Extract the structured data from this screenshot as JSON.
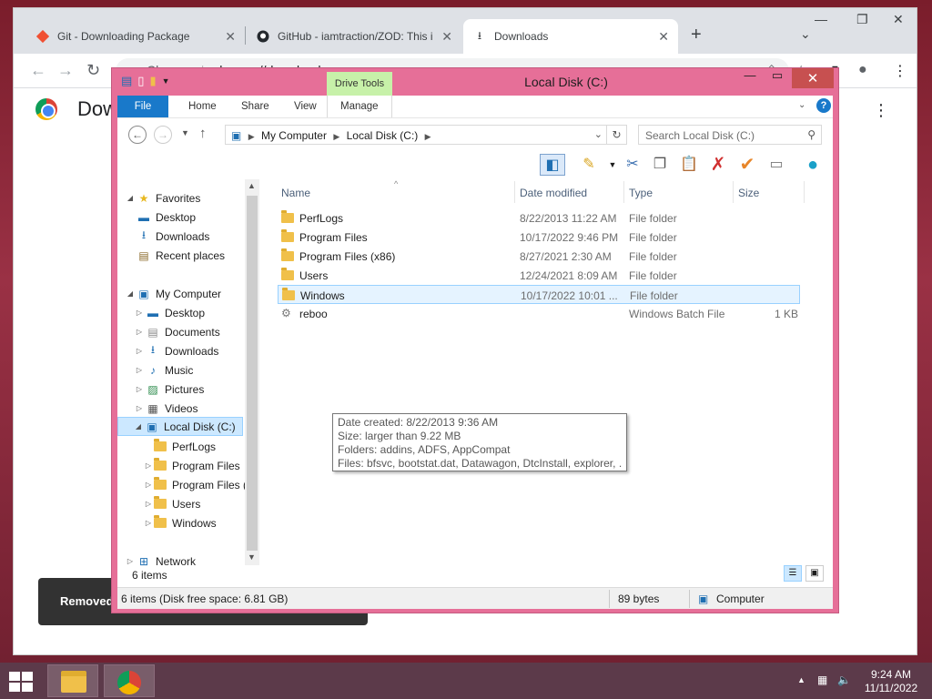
{
  "browser": {
    "tabs": [
      {
        "label": "Git - Downloading Package",
        "icon": "git-icon"
      },
      {
        "label": "GitHub - iamtraction/ZOD: This is",
        "icon": "github-icon"
      },
      {
        "label": "Downloads",
        "icon": "download-icon"
      }
    ],
    "new_tab": "+",
    "omnibox": {
      "site_label": "Chrome",
      "url": "chrome://downloads"
    },
    "page_title": "Downloads",
    "toast_text": "Removed"
  },
  "explorer": {
    "title": "Local Disk (C:)",
    "context_tab": "Drive Tools",
    "ribbon_tabs": [
      "File",
      "Home",
      "Share",
      "View",
      "Manage"
    ],
    "breadcrumb": [
      "My Computer",
      "Local Disk (C:)"
    ],
    "search_placeholder": "Search Local Disk (C:)",
    "nav_tree": [
      {
        "label": "Favorites",
        "level": 0,
        "expanded": true,
        "icon": "star-icon"
      },
      {
        "label": "Desktop",
        "level": 1,
        "icon": "desktop-icon"
      },
      {
        "label": "Downloads",
        "level": 1,
        "icon": "downloads-icon"
      },
      {
        "label": "Recent places",
        "level": 1,
        "icon": "recent-icon"
      },
      {
        "label": "My Computer",
        "level": 0,
        "expanded": true,
        "icon": "computer-icon"
      },
      {
        "label": "Desktop",
        "level": 1,
        "icon": "desktop-icon"
      },
      {
        "label": "Documents",
        "level": 1,
        "icon": "documents-icon"
      },
      {
        "label": "Downloads",
        "level": 1,
        "icon": "downloads-icon"
      },
      {
        "label": "Music",
        "level": 1,
        "icon": "music-icon"
      },
      {
        "label": "Pictures",
        "level": 1,
        "icon": "pictures-icon"
      },
      {
        "label": "Videos",
        "level": 1,
        "icon": "videos-icon"
      },
      {
        "label": "Local Disk (C:)",
        "level": 1,
        "expanded": true,
        "selected": true,
        "icon": "drive-icon"
      },
      {
        "label": "PerfLogs",
        "level": 2,
        "icon": "folder-icon"
      },
      {
        "label": "Program Files",
        "level": 2,
        "icon": "folder-icon"
      },
      {
        "label": "Program Files (",
        "level": 2,
        "icon": "folder-icon"
      },
      {
        "label": "Users",
        "level": 2,
        "icon": "folder-icon"
      },
      {
        "label": "Windows",
        "level": 2,
        "icon": "folder-icon"
      },
      {
        "label": "Network",
        "level": 0,
        "icon": "network-icon"
      }
    ],
    "columns": [
      "Name",
      "Date modified",
      "Type",
      "Size"
    ],
    "files": [
      {
        "name": "PerfLogs",
        "date": "8/22/2013 11:22 AM",
        "type": "File folder",
        "size": ""
      },
      {
        "name": "Program Files",
        "date": "10/17/2022 9:46 PM",
        "type": "File folder",
        "size": ""
      },
      {
        "name": "Program Files (x86)",
        "date": "8/27/2021 2:30 AM",
        "type": "File folder",
        "size": ""
      },
      {
        "name": "Users",
        "date": "12/24/2021 8:09 AM",
        "type": "File folder",
        "size": ""
      },
      {
        "name": "Windows",
        "date": "10/17/2022 10:01 ...",
        "type": "File folder",
        "size": "",
        "highlighted": true
      },
      {
        "name": "reboo",
        "date": "",
        "type": "Windows Batch File",
        "size": "1 KB"
      }
    ],
    "tooltip": [
      "Date created: 8/22/2013 9:36 AM",
      "Size: larger than 9.22 MB",
      "Folders: addins, ADFS, AppCompat",
      "Files: bfsvc, bootstat.dat, Datawagon, DtcInstall, explorer, ..."
    ],
    "item_count": "6 items",
    "status": {
      "left": "6 items (Disk free space: 6.81 GB)",
      "size": "89 bytes",
      "location": "Computer"
    }
  },
  "taskbar": {
    "time": "9:24 AM",
    "date": "11/11/2022"
  },
  "colors": {
    "explorer_frame": "#e66f98",
    "file_tab": "#1979ca",
    "drive_tools": "#c7f1a9",
    "taskbar": "#5c3a4a"
  }
}
